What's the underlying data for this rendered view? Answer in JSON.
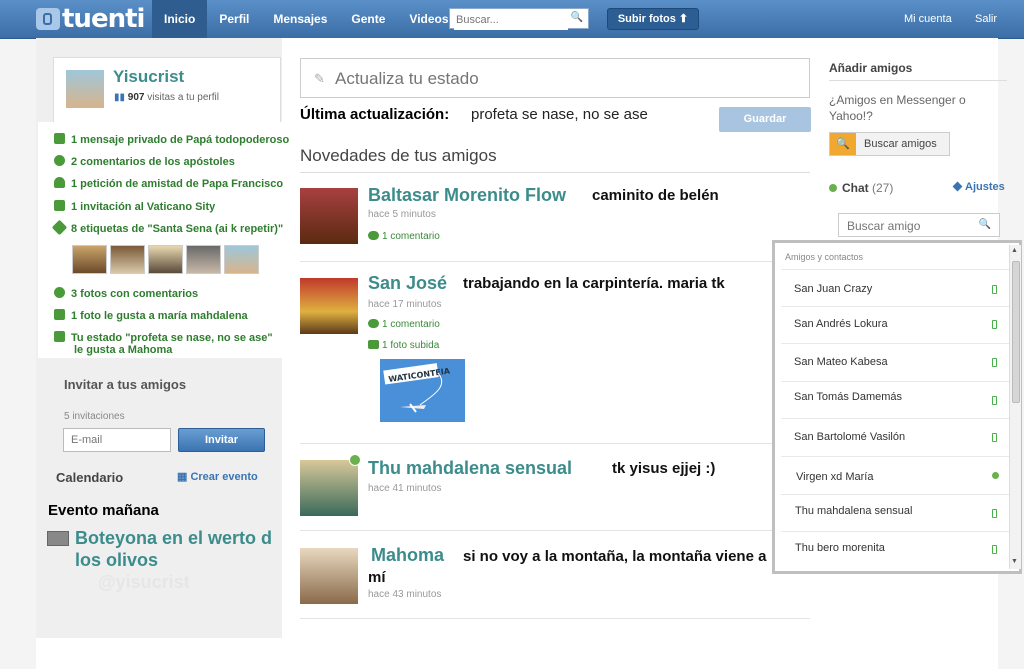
{
  "topbar": {
    "logo": "tuenti",
    "nav": [
      "Inicio",
      "Perfil",
      "Mensajes",
      "Gente",
      "Videos"
    ],
    "search_placeholder": "Buscar...",
    "upload_label": "Subir fotos ⬆",
    "my_account": "Mi cuenta",
    "logout": "Salir"
  },
  "profile": {
    "name": "Yisucrist",
    "visits_count": "907",
    "visits_label": "visitas a tu perfil"
  },
  "notifications": [
    "1 mensaje privado de Papá todopoderoso",
    "2 comentarios de los apóstoles",
    "1 petición de amistad de Papa Francisco",
    "1 invitación al Vaticano Sity",
    "8 etiquetas de \"Santa Sena (ai k repetir)\"",
    "3 fotos con comentarios",
    "1 foto le gusta a maría mahdalena",
    "Tu estado \"profeta se nase, no se ase\"",
    "le gusta a Mahoma"
  ],
  "invite": {
    "title": "Invitar a tus amigos",
    "count": "5 invitaciones",
    "email_placeholder": "E-mail",
    "button": "Invitar"
  },
  "calendar": {
    "title": "Calendario",
    "create": "Crear evento",
    "tomorrow": "Evento mañana",
    "event": "Boteyona en el werto d los olivos"
  },
  "watermark": "@yisucrist",
  "status": {
    "placeholder": "Actualiza tu estado",
    "last_update_label": "Última actualización:",
    "last_update_value": "profeta se nase, no se ase",
    "save": "Guardar"
  },
  "news": {
    "title": "Novedades de tus amigos",
    "items": [
      {
        "name": "Baltasar Morenito Flow",
        "status": "caminito de belén",
        "time": "hace 5 minutos",
        "comments": "1 comentario"
      },
      {
        "name": "San José",
        "status": "trabajando en la carpintería. maria tk",
        "time": "hace 17 minutos",
        "comments": "1 comentario",
        "photo": "1 foto subida",
        "photo_text": "WATICONTEIA"
      },
      {
        "name": "Thu mahdalena sensual",
        "status": "tk yisus ejjej :)",
        "time": "hace 41 minutos"
      },
      {
        "name": "Mahoma",
        "status": "si no voy a la montaña, la montaña viene a mí",
        "time": "hace 43 minutos"
      }
    ]
  },
  "right": {
    "add_friends": "Añadir amigos",
    "messenger_q": "¿Amigos en Messenger o Yahoo!?",
    "search_friends": "Buscar amigos",
    "chat": "Chat",
    "chat_count": "(27)",
    "settings": "Ajustes",
    "chat_search_placeholder": "Buscar amigo"
  },
  "contacts": {
    "title": "Amigos y contactos",
    "list": [
      "San Juan Crazy",
      "San Andrés Lokura",
      "San Mateo Kabesa",
      "San Tomás Damemás",
      "San Bartolomé Vasilón",
      "Virgen xd María",
      "Thu mahdalena sensual",
      "Thu bero morenita"
    ]
  },
  "colors": {
    "topbar": "#3c6ea6",
    "accent_name": "#3d8c8c",
    "notif_green": "#2f7d2f",
    "online": "#6ab04c",
    "search_btn": "#f0a830"
  }
}
